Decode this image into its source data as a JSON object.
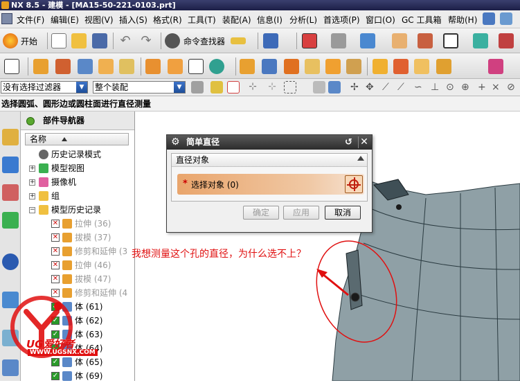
{
  "window": {
    "title": "NX 8.5 - 建模 - [MA15-50-221-0103.prt]"
  },
  "menu": {
    "items": [
      "文件(F)",
      "编辑(E)",
      "视图(V)",
      "插入(S)",
      "格式(R)",
      "工具(T)",
      "装配(A)",
      "信息(I)",
      "分析(L)",
      "首选项(P)",
      "窗口(O)",
      "GC 工具箱",
      "帮助(H)"
    ]
  },
  "toolbar": {
    "start_label": "开始",
    "command_finder_label": "命令查找器"
  },
  "selection_bar": {
    "filter_value": "没有选择过滤器",
    "scope_value": "整个装配"
  },
  "cue_line": {
    "text": "选择圆弧、圆形边或圆柱面进行直径测量"
  },
  "part_navigator": {
    "title": "部件导航器",
    "column_name": "名称",
    "nodes": [
      {
        "label": "历史记录模式",
        "state": "normal"
      },
      {
        "label": "模型视图",
        "state": "normal"
      },
      {
        "label": "摄像机",
        "state": "normal"
      },
      {
        "label": "组",
        "state": "normal"
      },
      {
        "label": "模型历史记录",
        "state": "normal"
      },
      {
        "label": "拉伸 (36)",
        "state": "suppressed"
      },
      {
        "label": "拔模 (37)",
        "state": "suppressed"
      },
      {
        "label": "修剪和延伸 (3",
        "state": "suppressed"
      },
      {
        "label": "拉伸 (46)",
        "state": "suppressed"
      },
      {
        "label": "拔模 (47)",
        "state": "suppressed"
      },
      {
        "label": "修剪和延伸 (4",
        "state": "suppressed"
      },
      {
        "label": "体 (61)",
        "state": "active"
      },
      {
        "label": "体 (62)",
        "state": "active"
      },
      {
        "label": "体 (63)",
        "state": "active"
      },
      {
        "label": "体 (64)",
        "state": "active"
      },
      {
        "label": "体 (65)",
        "state": "active"
      },
      {
        "label": "体 (69)",
        "state": "active"
      }
    ]
  },
  "dialog": {
    "title": "简单直径",
    "group_title": "直径对象",
    "select_label": "选择对象 (0)",
    "ok_label": "确定",
    "apply_label": "应用",
    "cancel_label": "取消"
  },
  "annotation": {
    "text": "我想测量这个孔的直径，为什么选不上？"
  },
  "watermark": {
    "brand": "UG爱好者",
    "url": "WWW.UGSNX.COM"
  },
  "colors": {
    "accent_red": "#e01010",
    "selection_orange": "#e9a56c",
    "model_gray": "#8fa0a6"
  }
}
